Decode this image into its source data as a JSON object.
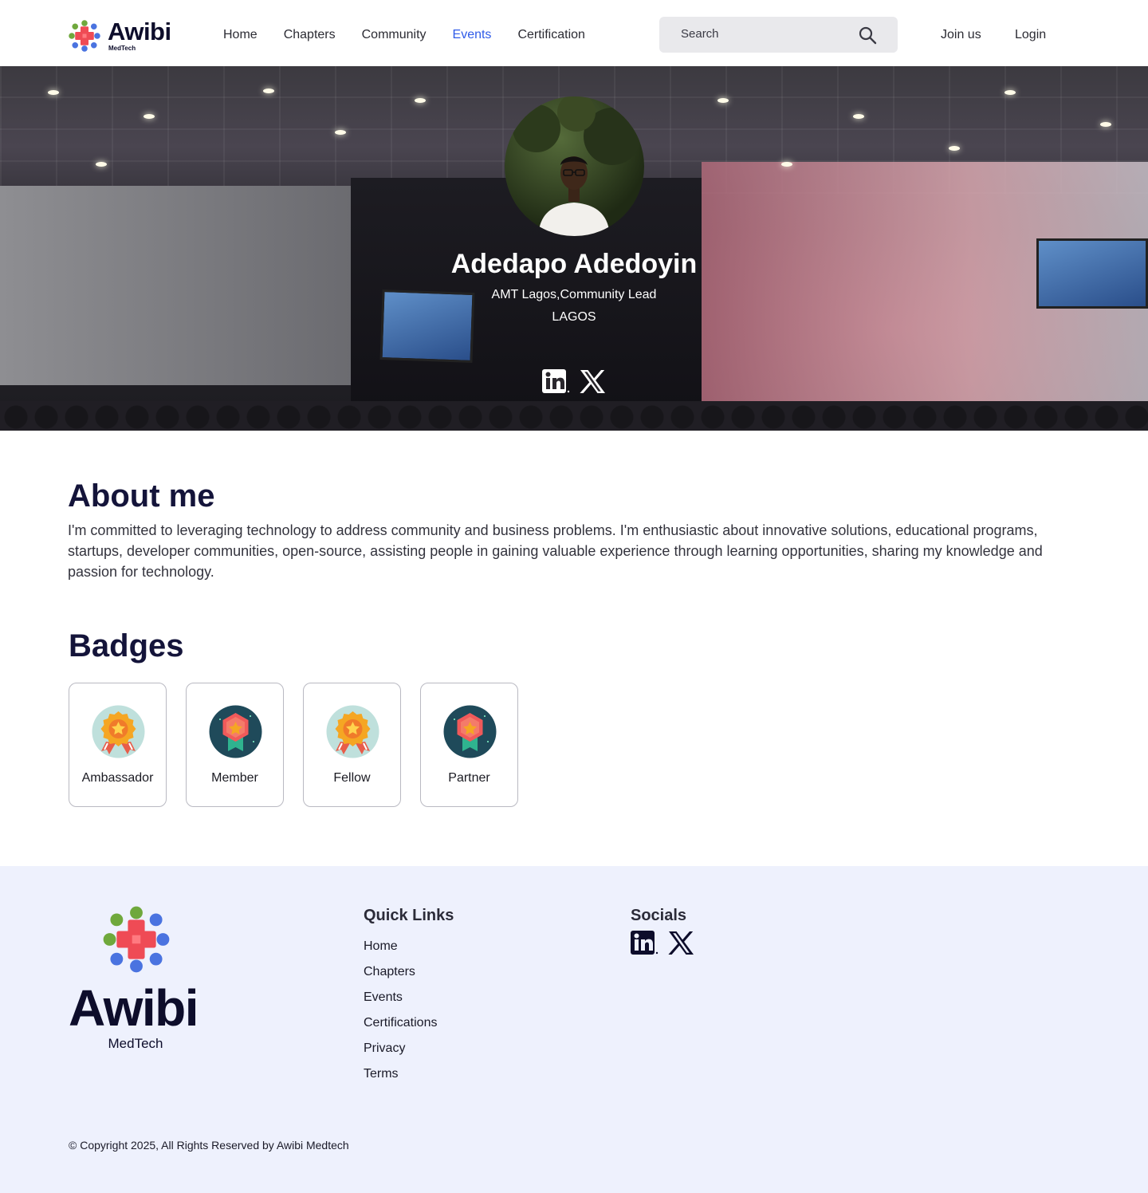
{
  "brand": {
    "name": "Awibi",
    "sub": "MedTech"
  },
  "nav": {
    "links": [
      {
        "label": "Home",
        "active": false
      },
      {
        "label": "Chapters",
        "active": false
      },
      {
        "label": "Community",
        "active": false
      },
      {
        "label": "Events",
        "active": true
      },
      {
        "label": "Certification",
        "active": false
      }
    ],
    "accent_color": "#2f5be8"
  },
  "search": {
    "placeholder": "Search",
    "icon": "search-icon"
  },
  "auth": {
    "join_label": "Join us",
    "login_label": "Login"
  },
  "profile": {
    "name": "Adedapo Adedoyin",
    "role": "AMT Lagos,Community Lead",
    "location": "LAGOS",
    "socials": [
      "linkedin-icon",
      "x-icon"
    ]
  },
  "about": {
    "title": "About me",
    "text": "I'm committed to leveraging technology to address community and business problems. I'm enthusiastic about innovative solutions, educational programs, startups, developer communities, open-source, assisting people in gaining valuable experience through learning opportunities, sharing my knowledge and passion for technology."
  },
  "badges": {
    "title": "Badges",
    "items": [
      {
        "label": "Ambassador",
        "style": "gold"
      },
      {
        "label": "Member",
        "style": "teal"
      },
      {
        "label": "Fellow",
        "style": "gold"
      },
      {
        "label": "Partner",
        "style": "teal"
      }
    ]
  },
  "footer": {
    "logo_word": "Awibi",
    "logo_sub": "MedTech",
    "quick_links_title": "Quick Links",
    "quick_links": [
      "Home",
      "Chapters",
      "Events",
      "Certifications",
      "Privacy",
      "Terms"
    ],
    "socials_title": "Socials",
    "copyright": "© Copyright 2025, All Rights Reserved by Awibi Medtech",
    "background": "#eef1fd"
  }
}
